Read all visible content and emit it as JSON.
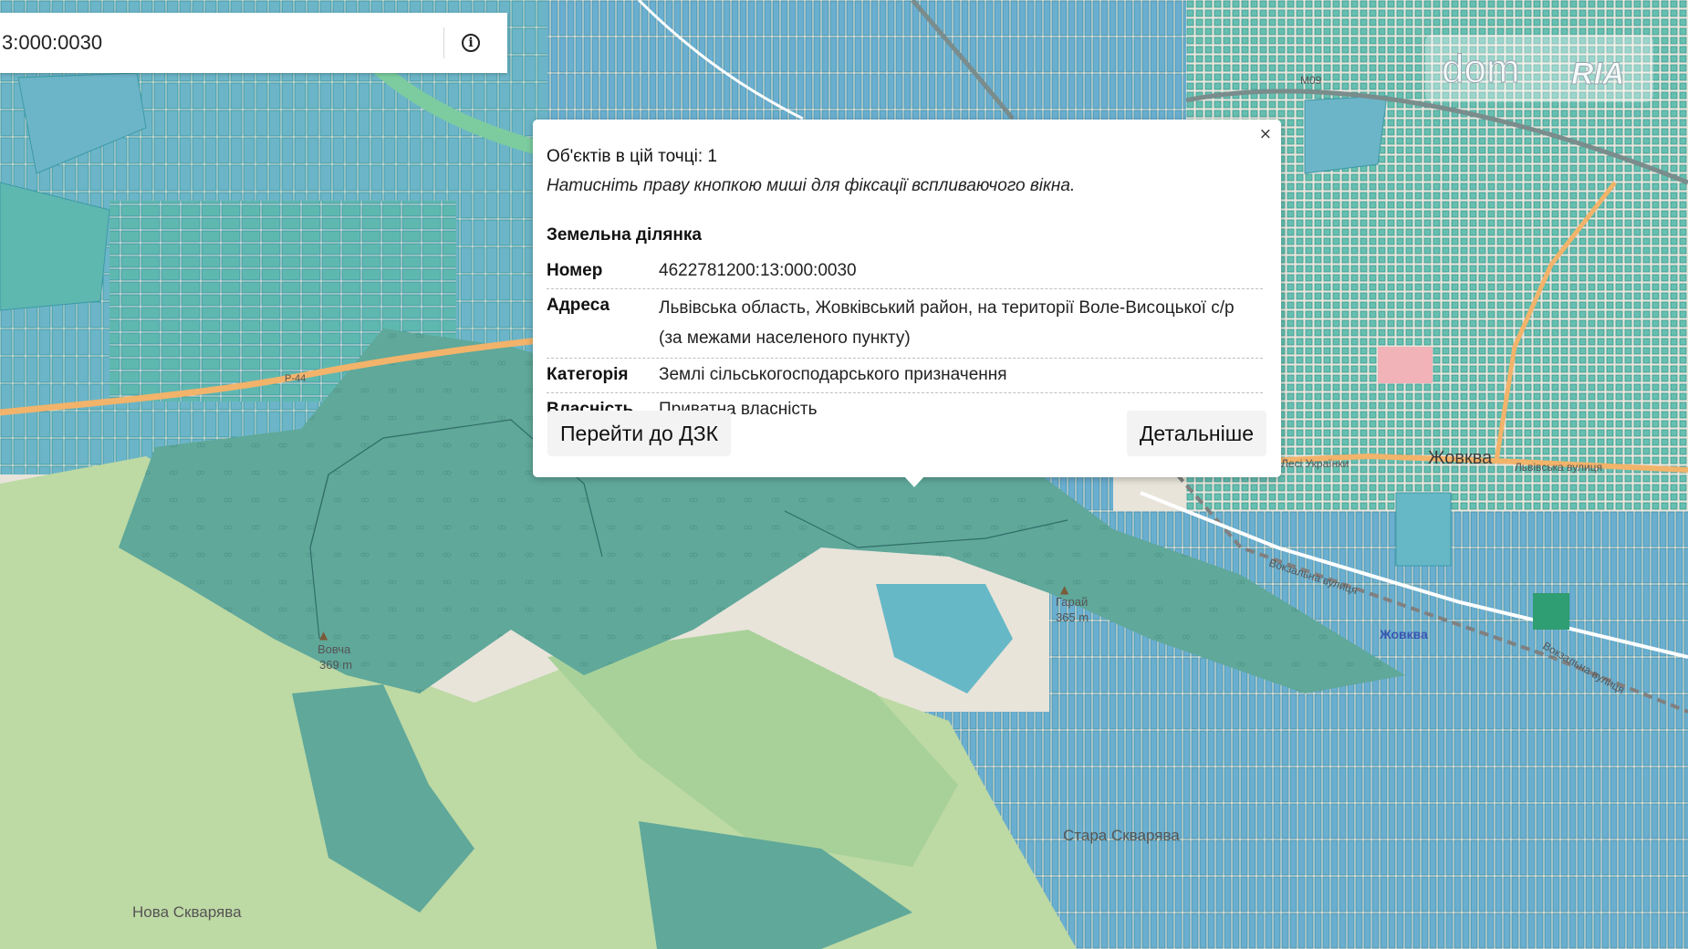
{
  "search": {
    "value": "3:000:0030"
  },
  "popup": {
    "close_label": "×",
    "objects_count": "Об'єктів в цій точці: 1",
    "hint": "Натисніть праву кнопкою миші для фіксації вспливаючого вікна.",
    "section_title": "Земельна ділянка",
    "rows": [
      {
        "label": "Номер",
        "value": "4622781200:13:000:0030"
      },
      {
        "label": "Адреса",
        "value_line1": "Львівська область, Жовківський район, на території Воле-Висоцької с/р",
        "value_line2": "(за межами населеного пункту)"
      },
      {
        "label": "Категорія",
        "value": "Землі сільськогосподарського призначення"
      },
      {
        "label": "Власність",
        "value": "Приватна власність"
      }
    ],
    "buttons": {
      "dzk": "Перейти до ДЗК",
      "more": "Детальніше"
    }
  },
  "map": {
    "labels": {
      "town": "Жовква",
      "station": "Жовква",
      "street1": "Вулиця Лесі Українки",
      "street2": "Львівська вулиця",
      "street3": "Вокзальна вулиця",
      "street4": "Вокзальна вулиця",
      "peak1_name": "Вовча",
      "peak1_height": "369 m",
      "peak2_name": "Гарай",
      "peak2_height": "365 m",
      "village1": "Нова Скварява",
      "village2": "Стара Скварява",
      "road1": "P-44",
      "road2": "М09"
    },
    "colors": {
      "parcel": "#6cb5c8",
      "parcel_dark": "#3d9aa6",
      "forest": "#5fa89a",
      "meadow": "#b9d6a0",
      "land": "#e8e4da",
      "road_orange": "#f2b36b",
      "railway": "#808080"
    }
  },
  "watermark": {
    "left": "dom",
    "right": "RIA"
  }
}
